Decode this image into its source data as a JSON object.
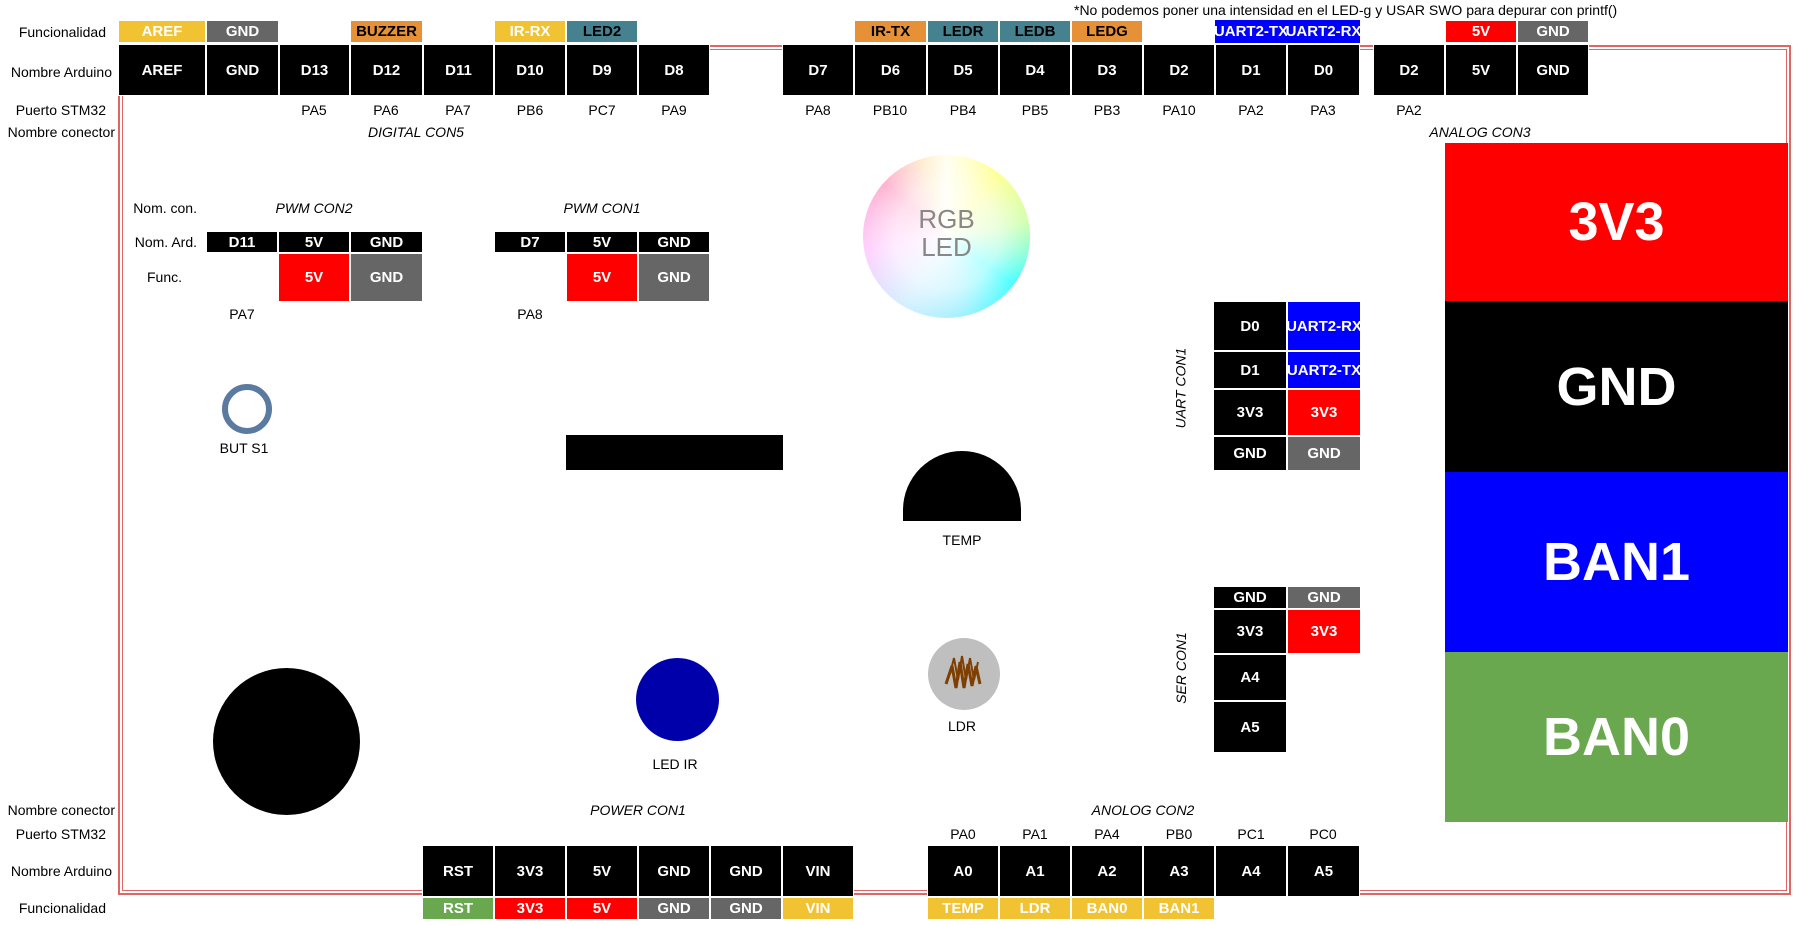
{
  "note": "*No podemos poner una intensidad en el LED-g y USAR SWO para depurar con printf()",
  "row_labels": {
    "funcionalidad": "Funcionalidad",
    "nombre_arduino": "Nombre Arduino",
    "puerto_stm32": "Puerto STM32",
    "nombre_conector": "Nombre conector"
  },
  "top": {
    "func": [
      "AREF",
      "GND",
      "BUZZER",
      "IR-RX",
      "LED2",
      "IR-TX",
      "LEDR",
      "LEDB",
      "LEDG",
      "UART2-TX",
      "UART2-RX",
      "5V",
      "GND"
    ],
    "arduino": [
      "AREF",
      "GND",
      "D13",
      "D12",
      "D11",
      "D10",
      "D9",
      "D8",
      "D7",
      "D6",
      "D5",
      "D4",
      "D3",
      "D2",
      "D1",
      "D0",
      "D2",
      "5V",
      "GND"
    ],
    "stm32": [
      "PA5",
      "PA6",
      "PA7",
      "PB6",
      "PC7",
      "PA9",
      "PA8",
      "PB10",
      "PB4",
      "PB5",
      "PB3",
      "PA10",
      "PA2",
      "PA3",
      "PA2"
    ],
    "con_digital": "DIGITAL CON5",
    "con_analog3": "ANALOG CON3"
  },
  "pwm": {
    "labels": {
      "con": "Nom. con.",
      "ard": "Nom. Ard.",
      "func": "Func."
    },
    "con2": {
      "name": "PWM CON2",
      "ard": [
        "D11",
        "5V",
        "GND"
      ],
      "func": [
        "5V",
        "GND"
      ],
      "port": "PA7"
    },
    "con1": {
      "name": "PWM CON1",
      "ard": [
        "D7",
        "5V",
        "GND"
      ],
      "func": [
        "5V",
        "GND"
      ],
      "port": "PA8"
    }
  },
  "components": {
    "rgb": "RGB\nLED",
    "rgb_l1": "RGB",
    "rgb_l2": "LED",
    "button": "BUT S1",
    "temp": "TEMP",
    "ldr": "LDR",
    "led_ir": "LED IR"
  },
  "uart": {
    "name": "UART CON1",
    "ard": [
      "D0",
      "D1",
      "3V3",
      "GND"
    ],
    "func": [
      "UART2-RX",
      "UART2-TX",
      "3V3",
      "GND"
    ]
  },
  "ser": {
    "name": "SER CON1",
    "ard": [
      "GND",
      "3V3",
      "A4",
      "A5"
    ],
    "func": [
      "GND",
      "3V3"
    ]
  },
  "analog3_blocks": [
    "3V3",
    "GND",
    "BAN1",
    "BAN0"
  ],
  "bottom": {
    "power_name": "POWER CON1",
    "analog2_name": "ANOLOG CON2",
    "stm32": [
      "PA0",
      "PA1",
      "PA4",
      "PB0",
      "PC1",
      "PC0"
    ],
    "arduino": [
      "RST",
      "3V3",
      "5V",
      "GND",
      "GND",
      "VIN",
      "A0",
      "A1",
      "A2",
      "A3",
      "A4",
      "A5"
    ],
    "func": [
      "RST",
      "3V3",
      "5V",
      "GND",
      "GND",
      "VIN",
      "TEMP",
      "LDR",
      "BAN0",
      "BAN1"
    ]
  },
  "colors": {
    "board_border": "#e06666",
    "red": "#ff0000",
    "black": "#000000",
    "grey": "#666666",
    "blue": "#0000ff",
    "yellow": "#f1c232",
    "orange": "#e69138",
    "teal": "#45818e",
    "green": "#6aa84f",
    "led_ir": "#0000aa",
    "button_ring": "#5b7aa0"
  }
}
